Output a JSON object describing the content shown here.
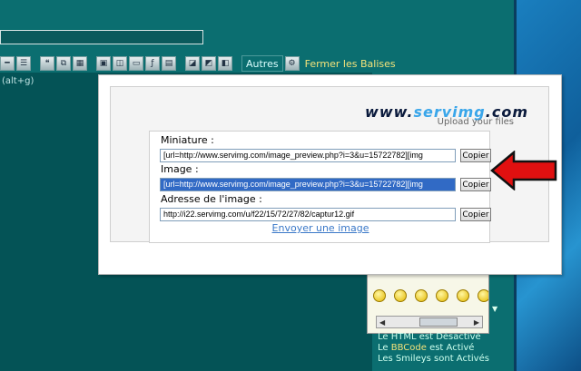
{
  "toolbar": {
    "autres_label": "Autres",
    "fermer_label": "Fermer les Balises",
    "alt_hint": "(alt+g)"
  },
  "popup": {
    "logo_prefix": "www.",
    "logo_brand": "servimg",
    "logo_suffix": ".com",
    "subtitle": "Upload your files",
    "rows": [
      {
        "label": "Miniature :",
        "value": "[url=http://www.servimg.com/image_preview.php?i=3&u=15722782][img",
        "button": "Copier"
      },
      {
        "label": "Image :",
        "value": "[url=http://www.servimg.com/image_preview.php?i=3&u=15722782][img",
        "button": "Copier"
      },
      {
        "label": "Adresse de l'image :",
        "value": "http://i22.servimg.com/u/f22/15/72/27/82/captur12.gif",
        "button": "Copier"
      }
    ],
    "send_link": "Envoyer une image"
  },
  "status": {
    "line1_prefix": "Le HTML est Désactivé",
    "line2_a": "Le ",
    "line2_b": "BBCode",
    "line2_c": " est Activé",
    "line3": "Les Smileys sont Activés"
  },
  "colors": {
    "teal": "#0b6e70",
    "selection": "#316ac5",
    "arrow": "#e01010",
    "link": "#3a78c8"
  }
}
